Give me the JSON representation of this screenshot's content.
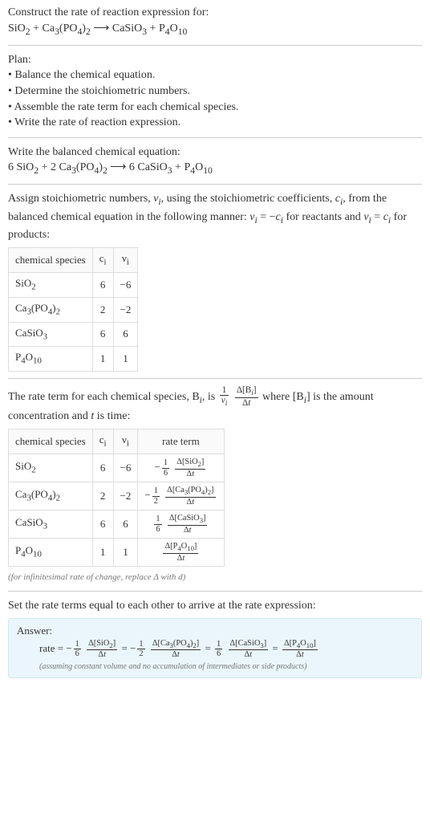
{
  "header": {
    "prompt": "Construct the rate of reaction expression for:",
    "equation": "SiO<sub>2</sub> + Ca<sub>3</sub>(PO<sub>4</sub>)<sub>2</sub>  ⟶  CaSiO<sub>3</sub> + P<sub>4</sub>O<sub>10</sub>"
  },
  "plan": {
    "title": "Plan:",
    "steps": [
      "Balance the chemical equation.",
      "Determine the stoichiometric numbers.",
      "Assemble the rate term for each chemical species.",
      "Write the rate of reaction expression."
    ]
  },
  "balanced": {
    "intro": "Write the balanced chemical equation:",
    "equation": "6 SiO<sub>2</sub> + 2 Ca<sub>3</sub>(PO<sub>4</sub>)<sub>2</sub>  ⟶  6 CaSiO<sub>3</sub> + P<sub>4</sub>O<sub>10</sub>"
  },
  "stoich": {
    "intro": "Assign stoichiometric numbers, <i>ν<sub>i</sub></i>, using the stoichiometric coefficients, <i>c<sub>i</sub></i>, from the balanced chemical equation in the following manner: <i>ν<sub>i</sub></i> = −<i>c<sub>i</sub></i> for reactants and <i>ν<sub>i</sub></i> = <i>c<sub>i</sub></i> for products:",
    "headers": [
      "chemical species",
      "c<sub>i</sub>",
      "ν<sub>i</sub>"
    ],
    "rows": [
      {
        "species": "SiO<sub>2</sub>",
        "c": "6",
        "nu": "−6"
      },
      {
        "species": "Ca<sub>3</sub>(PO<sub>4</sub>)<sub>2</sub>",
        "c": "2",
        "nu": "−2"
      },
      {
        "species": "CaSiO<sub>3</sub>",
        "c": "6",
        "nu": "6"
      },
      {
        "species": "P<sub>4</sub>O<sub>10</sub>",
        "c": "1",
        "nu": "1"
      }
    ]
  },
  "rateterm": {
    "intro_pre": "The rate term for each chemical species, B<sub><i>i</i></sub>, is ",
    "intro_post": " where [B<sub><i>i</i></sub>] is the amount concentration and <i>t</i> is time:",
    "headers": [
      "chemical species",
      "c<sub>i</sub>",
      "ν<sub>i</sub>",
      "rate term"
    ],
    "rows": [
      {
        "species": "SiO<sub>2</sub>",
        "c": "6",
        "nu": "−6",
        "coef": "−",
        "fracN": "1",
        "fracD": "6",
        "dNum": "Δ[SiO<sub>2</sub>]",
        "dDen": "Δ<i>t</i>"
      },
      {
        "species": "Ca<sub>3</sub>(PO<sub>4</sub>)<sub>2</sub>",
        "c": "2",
        "nu": "−2",
        "coef": "−",
        "fracN": "1",
        "fracD": "2",
        "dNum": "Δ[Ca<sub>3</sub>(PO<sub>4</sub>)<sub>2</sub>]",
        "dDen": "Δ<i>t</i>"
      },
      {
        "species": "CaSiO<sub>3</sub>",
        "c": "6",
        "nu": "6",
        "coef": "",
        "fracN": "1",
        "fracD": "6",
        "dNum": "Δ[CaSiO<sub>3</sub>]",
        "dDen": "Δ<i>t</i>"
      },
      {
        "species": "P<sub>4</sub>O<sub>10</sub>",
        "c": "1",
        "nu": "1",
        "coef": "",
        "fracN": "",
        "fracD": "",
        "dNum": "Δ[P<sub>4</sub>O<sub>10</sub>]",
        "dDen": "Δ<i>t</i>"
      }
    ],
    "caption": "(for infinitesimal rate of change, replace Δ with d)"
  },
  "final": {
    "intro": "Set the rate terms equal to each other to arrive at the rate expression:",
    "answer_label": "Answer:",
    "expr_prefix": "rate = ",
    "terms": [
      {
        "coef": "−",
        "fracN": "1",
        "fracD": "6",
        "dNum": "Δ[SiO<sub>2</sub>]",
        "dDen": "Δ<i>t</i>"
      },
      {
        "coef": "−",
        "fracN": "1",
        "fracD": "2",
        "dNum": "Δ[Ca<sub>3</sub>(PO<sub>4</sub>)<sub>2</sub>]",
        "dDen": "Δ<i>t</i>"
      },
      {
        "coef": "",
        "fracN": "1",
        "fracD": "6",
        "dNum": "Δ[CaSiO<sub>3</sub>]",
        "dDen": "Δ<i>t</i>"
      },
      {
        "coef": "",
        "fracN": "",
        "fracD": "",
        "dNum": "Δ[P<sub>4</sub>O<sub>10</sub>]",
        "dDen": "Δ<i>t</i>"
      }
    ],
    "caption": "(assuming constant volume and no accumulation of intermediates or side products)"
  }
}
